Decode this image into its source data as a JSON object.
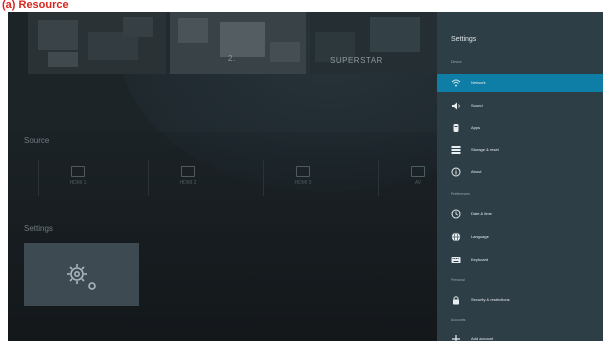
{
  "figure_label": "(a) Resource",
  "banners": {
    "left_text": "2.",
    "mid_text": "SUPERSTAR"
  },
  "sections": {
    "source_title": "Source",
    "settings_title": "Settings"
  },
  "sources": [
    {
      "label": "HDMI 1"
    },
    {
      "label": "HDMI 2"
    },
    {
      "label": "HDMI 3"
    },
    {
      "label": "AV"
    }
  ],
  "panel": {
    "title": "Settings",
    "categories": {
      "device": "Device",
      "preferences": "Preferences",
      "personal": "Personal",
      "accounts": "Accounts"
    },
    "items": [
      {
        "label": "Network",
        "icon": "wifi-icon",
        "selected": true
      },
      {
        "label": "Sound",
        "icon": "speaker-icon"
      },
      {
        "label": "Apps",
        "icon": "apps-icon"
      },
      {
        "label": "Storage & reset",
        "icon": "storage-icon"
      },
      {
        "label": "About",
        "icon": "info-icon"
      },
      {
        "label": "Date & time",
        "icon": "clock-icon"
      },
      {
        "label": "Language",
        "icon": "globe-icon"
      },
      {
        "label": "Keyboard",
        "icon": "keyboard-icon"
      },
      {
        "label": "Security & restrictions",
        "icon": "lock-icon"
      },
      {
        "label": "Add account",
        "icon": "plus-icon"
      }
    ]
  },
  "colors": {
    "accent": "#0e7ea6",
    "panel_bg": "#2e3e46",
    "screen_bg": "#1d2428",
    "label_red": "#d7261e"
  }
}
